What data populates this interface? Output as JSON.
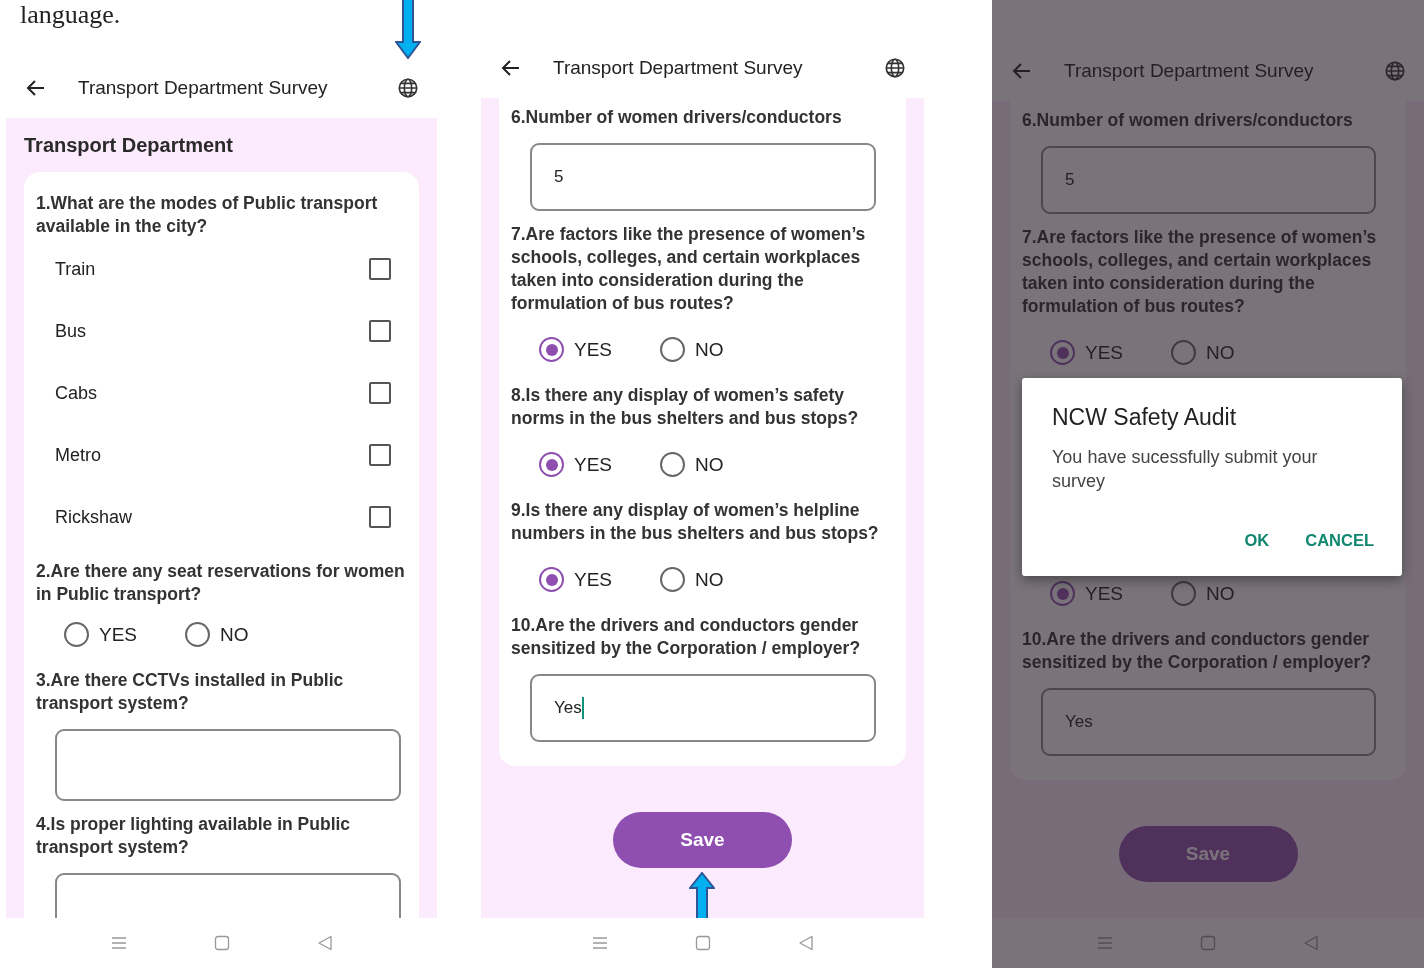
{
  "caption": "language.",
  "screens": [
    {
      "app_bar": {
        "title": "Transport Department Survey"
      },
      "globe_pointed": true,
      "section_title": "Transport Department",
      "questions": [
        {
          "kind": "checklist",
          "text": "1.What are the modes of Public transport available in the city?",
          "options": [
            {
              "label": "Train",
              "checked": false
            },
            {
              "label": "Bus",
              "checked": false
            },
            {
              "label": "Cabs",
              "checked": false
            },
            {
              "label": "Metro",
              "checked": false
            },
            {
              "label": "Rickshaw",
              "checked": false
            }
          ]
        },
        {
          "kind": "radio",
          "text": "2.Are there any seat reservations for women in Public transport?",
          "options": [
            {
              "label": "YES",
              "selected": false
            },
            {
              "label": "NO",
              "selected": false
            }
          ]
        },
        {
          "kind": "text",
          "text": "3.Are there CCTVs installed in Public transport system?"
        },
        {
          "kind": "text",
          "text": "4.Is proper lighting available in Public transport system?"
        }
      ]
    },
    {
      "app_bar": {
        "title": "Transport Department Survey"
      },
      "save_pointed": true,
      "questions": [
        {
          "kind": "text",
          "text": "6.Number of women drivers/conductors",
          "value": "5"
        },
        {
          "kind": "radio",
          "text": "7.Are factors like the presence of women’s schools, colleges, and certain workplaces taken into consideration during the formulation of bus routes?",
          "options": [
            {
              "label": "YES",
              "selected": true
            },
            {
              "label": "NO",
              "selected": false
            }
          ]
        },
        {
          "kind": "radio",
          "text": "8.Is there any display of women’s safety norms in the bus shelters and bus stops?",
          "options": [
            {
              "label": "YES",
              "selected": true
            },
            {
              "label": "NO",
              "selected": false
            }
          ]
        },
        {
          "kind": "radio",
          "text": "9.Is there any display of women’s helpline numbers in the bus shelters and bus stops?",
          "options": [
            {
              "label": "YES",
              "selected": true
            },
            {
              "label": "NO",
              "selected": false
            }
          ]
        },
        {
          "kind": "text",
          "text": "10.Are the drivers and conductors gender sensitized by the Corporation / employer?",
          "value": "Yes",
          "focused": true
        }
      ],
      "save_button": "Save"
    },
    {
      "app_bar": {
        "title": "Transport Department Survey"
      },
      "questions": [
        {
          "kind": "text",
          "text": "6.Number of women drivers/conductors",
          "value": "5"
        },
        {
          "kind": "radio",
          "text": "7.Are factors like the presence of women’s schools, colleges, and certain workplaces taken into consideration during the formulation of bus routes?",
          "options": [
            {
              "label": "YES",
              "selected": true
            },
            {
              "label": "NO",
              "selected": false
            }
          ]
        },
        {
          "kind": "radio",
          "options": [
            {
              "label": "YES",
              "selected": true
            },
            {
              "label": "NO",
              "selected": false
            }
          ]
        },
        {
          "kind": "text",
          "text": "10.Are the drivers and conductors gender sensitized by the Corporation / employer?",
          "value": "Yes",
          "focused": false
        }
      ],
      "save_button": "Save",
      "dialog": {
        "title": "NCW Safety Audit",
        "message": "You have sucessfully submit your survey",
        "buttons": [
          "OK",
          "CANCEL"
        ]
      }
    }
  ]
}
